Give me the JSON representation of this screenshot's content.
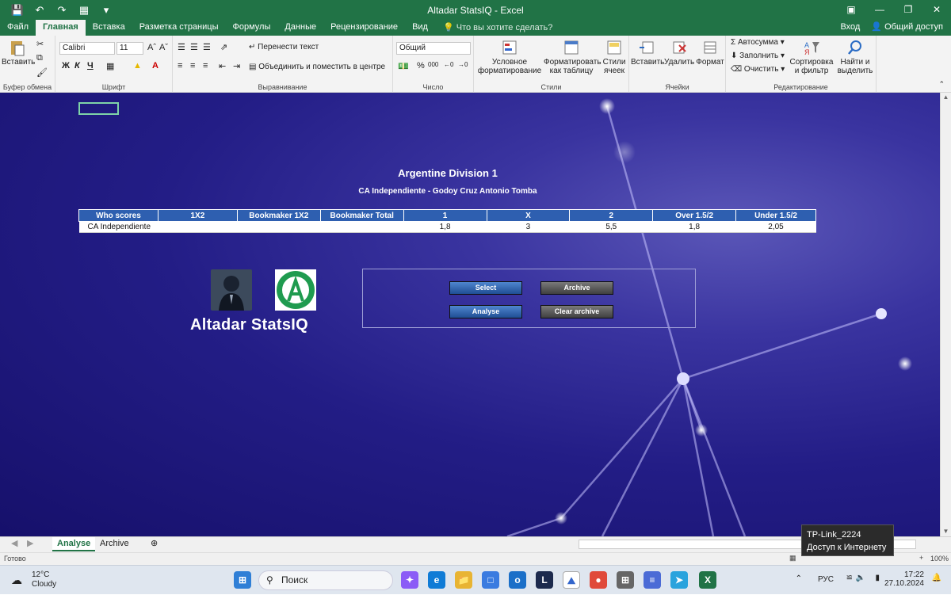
{
  "window": {
    "title": "Altadar StatsIQ - Excel"
  },
  "tabs": [
    "Файл",
    "Главная",
    "Вставка",
    "Разметка страницы",
    "Формулы",
    "Данные",
    "Рецензирование",
    "Вид"
  ],
  "tell_me": "Что вы хотите сделать?",
  "tabs_right": {
    "login": "Вход",
    "share": "Общий доступ"
  },
  "ribbon": {
    "clipboard": {
      "label": "Буфер обмена",
      "paste": "Вставить"
    },
    "font": {
      "label": "Шрифт",
      "name": "Calibri",
      "size": "11",
      "bold": "Ж",
      "italic": "К",
      "underline": "Ч"
    },
    "alignment": {
      "label": "Выравнивание",
      "wrap": "Перенести текст",
      "merge": "Объединить и поместить в центре"
    },
    "number": {
      "label": "Число",
      "format": "Общий"
    },
    "styles": {
      "label": "Стили",
      "conditional": "Условное форматирование",
      "as_table": "Форматировать как таблицу",
      "cell_styles": "Стили ячеек"
    },
    "cells": {
      "label": "Ячейки",
      "insert": "Вставить",
      "delete": "Удалить",
      "format": "Формат"
    },
    "editing": {
      "label": "Редактирование",
      "autosum": "Автосумма",
      "fill": "Заполнить",
      "clear": "Очистить",
      "sort": "Сортировка и фильтр",
      "find": "Найти и выделить"
    }
  },
  "sheet": {
    "league": "Argentine Division 1",
    "match": "CA Independiente - Godoy Cruz Antonio Tomba",
    "table": {
      "headers": [
        "Who scores",
        "1X2",
        "Bookmaker 1X2",
        "Bookmaker Total",
        "1",
        "X",
        "2",
        "Over 1.5/2",
        "Under 1.5/2"
      ],
      "row": [
        "CA Independiente",
        "",
        "",
        "",
        "1,8",
        "3",
        "5,5",
        "1,8",
        "2,05"
      ]
    },
    "brand": "Altadar StatsIQ",
    "buttons": {
      "select": "Select",
      "archive": "Archive",
      "analyse": "Analyse",
      "clear_archive": "Clear archive"
    }
  },
  "sheet_tabs": [
    "Analyse",
    "Archive"
  ],
  "status": {
    "ready": "Готово",
    "zoom": "100%"
  },
  "tooltip": {
    "network": "TP-Link_2224",
    "status": "Доступ к Интернету"
  },
  "taskbar": {
    "temp": "12°C",
    "weather": "Cloudy",
    "search": "Поиск",
    "lang": "РУС",
    "time": "17:22",
    "date": "27.10.2024"
  }
}
